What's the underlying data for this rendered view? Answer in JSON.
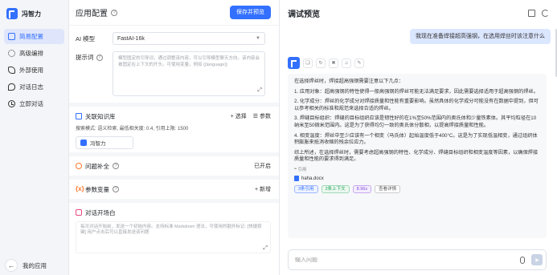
{
  "sidebar": {
    "logo_text": "冯智力",
    "items": [
      {
        "label": "简易配置",
        "icon": "box-icon",
        "active": true
      },
      {
        "label": "高级编排",
        "icon": "gear-icon",
        "active": false
      },
      {
        "label": "外部使用",
        "icon": "puzzle-icon",
        "active": false
      },
      {
        "label": "对话日志",
        "icon": "chat-icon",
        "active": false
      },
      {
        "label": "立即对话",
        "icon": "clock-icon",
        "active": false
      }
    ],
    "back_label": "我的应用"
  },
  "config": {
    "title": "应用配置",
    "save_label": "保存并预览",
    "model_label": "AI 模型",
    "model_value": "FastAI-16k",
    "prompt_label": "提示词",
    "prompt_placeholder": "模型固定的引导词，通过调整该内容，可以引导模型聊天方向。该内容会被固定在上下文的开头。可使用变量，例如 {{language}}",
    "kb": {
      "title": "关联知识库",
      "select_label": "+ 选择",
      "params_label": "参数",
      "meta": "搜索模式: 语义检索, 最低相关度: 0.4, 引用上限: 1500",
      "tag": "冯智力"
    },
    "question_guide": {
      "title": "问题补全",
      "value": "已开启"
    },
    "variables": {
      "title": "参数变量",
      "action": "+ 新增"
    },
    "opening": {
      "title": "对话开场白",
      "placeholder": "每次对话开始前，发送一个初始内容。支持标准 Markdown 语法，可使用的额外标记: [快捷按键] 用户点击后可以直接发送该问题"
    }
  },
  "chat": {
    "title": "调试预览",
    "user_message": "我现在准备焊接超高强钢，在选用焊丝时该注意什么",
    "answer": {
      "intro": "在选择焊丝时，焊接超高强钢需要注意以下几点：",
      "points": [
        "1. 应用对象：超高强钢的特性使得一般高强钢的焊丝可能无法满足要求，因此需要选择适用于超高强钢的焊丝。",
        "2. 化学成分：焊丝的化学成分对焊接质量和性能有重要影响。虽然具体的化学成分可能没有在数据中提到，但可以参考相关的标准和规范来选择合适的焊丝。",
        "3. 焊缝目标组织：焊缝的目标组织应该是韧性好的在1%至50%范围内的奥氏体和少量铁素体。其平均粒径在10纳米至50微米范围内。这是为了获得均匀一致的奥氏体分散相，以提高焊接质量和性能。",
        "4. 相变温度：焊丝中至少应该有一个相变（马氏体）起始温度低于400°C。这是为了实现低温相变，通过组织体积膨胀来抵消收缩的残余拉应力。"
      ],
      "summary": "综上所述，在选择焊丝时，需要考虑超高强钢的特性、化学成分、焊缝目标组织和相变温度等因素，以确保焊接质量和性能的要求得到满足。",
      "citation_label": "引用",
      "citation_file": "haha.docx",
      "badges": [
        "3条引用",
        "2条上下文",
        "8.96s",
        "查看详情"
      ]
    },
    "input_placeholder": "输入问题"
  },
  "colors": {
    "accent": "#3370ff",
    "user_bubble": "#dbe6ff",
    "card_bg": "#f7f8fa"
  }
}
